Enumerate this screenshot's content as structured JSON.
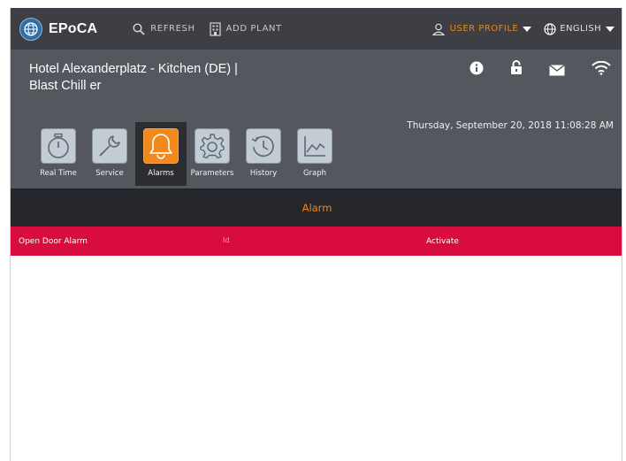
{
  "app": {
    "name": "EPoCA"
  },
  "topnav": {
    "refresh_label": "REFRESH",
    "add_plant_label": "ADD PLANT",
    "profile_label": "USER PROFILE",
    "language_label": "ENGLISH"
  },
  "header": {
    "plant_line1": "Hotel Alexanderplatz - Kitchen (DE) |",
    "plant_line2": "Blast Chill er",
    "datetime": "Thursday, September 20, 2018 11:08:28 AM"
  },
  "tabs": [
    {
      "label": "Real Time",
      "icon": "stopwatch-icon"
    },
    {
      "label": "Service",
      "icon": "wrench-icon"
    },
    {
      "label": "Alarms",
      "icon": "bell-icon",
      "active": true
    },
    {
      "label": "Parameters",
      "icon": "gear-icon"
    },
    {
      "label": "History",
      "icon": "history-icon"
    },
    {
      "label": "Graph",
      "icon": "chart-icon"
    }
  ],
  "alarm_section": {
    "title": "Alarm",
    "row": {
      "name": "Open Door Alarm",
      "id": "Id",
      "action": "Activate"
    }
  },
  "colors": {
    "accent_orange": "#f08a1c",
    "alarm_red": "#d80c3f",
    "nav_bg": "#3d3f44",
    "header_bg": "#54575d"
  }
}
